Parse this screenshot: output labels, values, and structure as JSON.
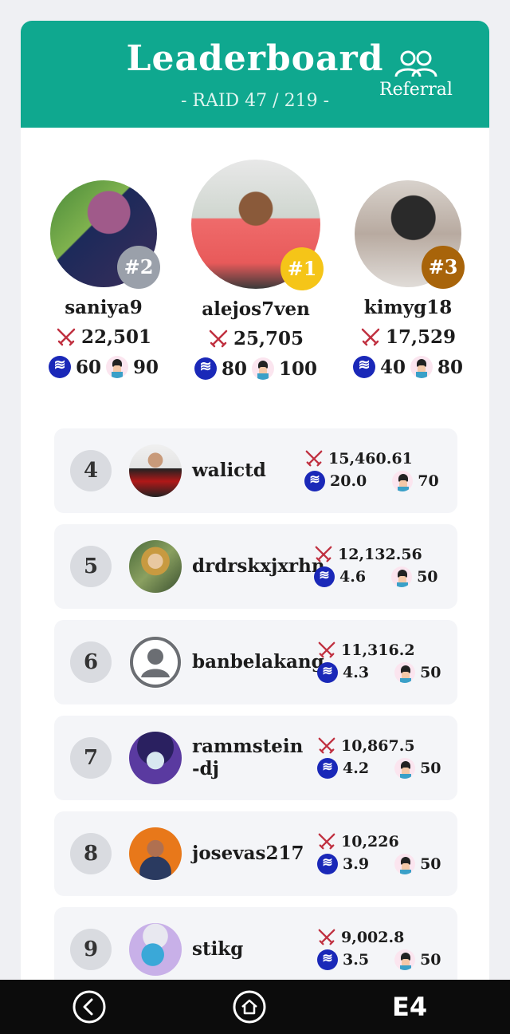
{
  "header": {
    "title": "Leaderboard",
    "subtitle": "- RAID 47 / 219 -",
    "referral_label": "Referral"
  },
  "podium": [
    {
      "rank": "#2",
      "name": "saniya9",
      "score": "22,501",
      "coin": "60",
      "toy": "90",
      "badge_color": "#9aa0aa"
    },
    {
      "rank": "#1",
      "name": "alejos7ven",
      "score": "25,705",
      "coin": "80",
      "toy": "100",
      "badge_color": "#f5c518"
    },
    {
      "rank": "#3",
      "name": "kimyg18",
      "score": "17,529",
      "coin": "40",
      "toy": "80",
      "badge_color": "#a8640a"
    }
  ],
  "rows": [
    {
      "rank": "4",
      "name": "walictd",
      "score": "15,460.61",
      "coin": "20.0",
      "toy": "70"
    },
    {
      "rank": "5",
      "name": "drdrskxjxrhn",
      "score": "12,132.56",
      "coin": "4.6",
      "toy": "50"
    },
    {
      "rank": "6",
      "name": "banbelakang",
      "score": "11,316.2",
      "coin": "4.3",
      "toy": "50"
    },
    {
      "rank": "7",
      "name": "rammstein-dj",
      "score": "10,867.5",
      "coin": "4.2",
      "toy": "50"
    },
    {
      "rank": "8",
      "name": "josevas217",
      "score": "10,226",
      "coin": "3.9",
      "toy": "50"
    },
    {
      "rank": "9",
      "name": "stikg",
      "score": "9,002.8",
      "coin": "3.5",
      "toy": "50"
    }
  ],
  "nav": {
    "back_icon": "back-icon",
    "home_icon": "home-icon",
    "brand_label": "E4"
  },
  "colors": {
    "accent": "#0fa88f",
    "coin": "#1a28b8",
    "sword": "#c03040"
  }
}
